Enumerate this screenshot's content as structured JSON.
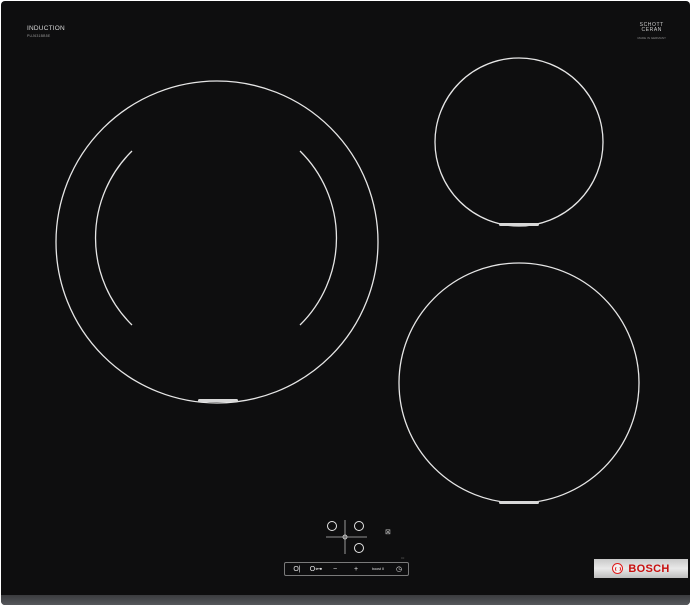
{
  "panel": {
    "brand_line": "INDUCTION",
    "model_line": "PUJ631BB5E",
    "glass_brand_line1": "SCHOTT",
    "glass_brand_line2": "CERAN",
    "glass_small": "MADE IN GERMANY",
    "mode_mark": "≈≈"
  },
  "controls": {
    "timer_short_symbol": "O|",
    "key_symbol": "O⊶",
    "minus_label": "−",
    "plus_label": "+",
    "boost_label": "boost II",
    "timer_symbol": "◷"
  },
  "brand_badge": {
    "label": "BOSCH",
    "logo": "bosch-ring-logo"
  },
  "colors": {
    "glass": "#0e0e0f",
    "zone_line": "#e8e8e8",
    "accent": "#c80f0f",
    "frame": "#4a4b4e"
  },
  "icons": [
    "zone-selector-icon",
    "lock-icon",
    "bosch-logo-icon",
    "timer-icon"
  ]
}
